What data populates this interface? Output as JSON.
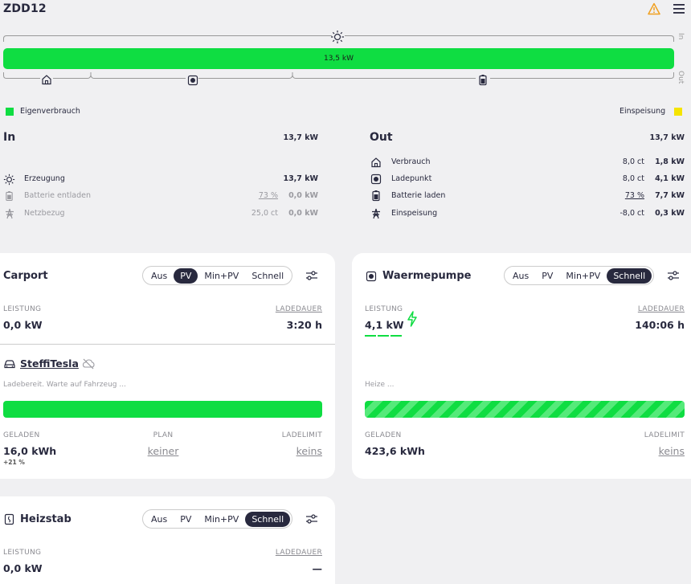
{
  "header": {
    "title": "ZDD12"
  },
  "energyflow": {
    "bar_label": "13,5 kW",
    "in_label": "In",
    "out_label": "Out",
    "legend_self": "Eigenverbrauch",
    "legend_feed": "Einspeisung",
    "colors": {
      "self": "#0fdd42",
      "feed": "#f5e400"
    }
  },
  "inflow": {
    "title": "In",
    "total": "13,7 kW",
    "rows": [
      {
        "label": "Erzeugung",
        "price": "",
        "value": "13,7 kW",
        "icon": "sun-icon"
      },
      {
        "label": "Batterie entladen",
        "price": "73 %",
        "value": "0,0 kW",
        "icon": "battery-icon"
      },
      {
        "label": "Netzbezug",
        "price": "25,0 ct",
        "value": "0,0 kW",
        "icon": "grid-tower-icon"
      }
    ]
  },
  "outflow": {
    "title": "Out",
    "total": "13,7 kW",
    "rows": [
      {
        "label": "Verbrauch",
        "price": "8,0 ct",
        "value": "1,8 kW",
        "icon": "home-icon"
      },
      {
        "label": "Ladepunkt",
        "price": "8,0 ct",
        "value": "4,1 kW",
        "icon": "charger-icon"
      },
      {
        "label": "Batterie laden",
        "price": "73 %",
        "value": "7,7 kW",
        "icon": "battery-icon"
      },
      {
        "label": "Einspeisung",
        "price": "-8,0 ct",
        "value": "0,3 kW",
        "icon": "grid-tower-icon"
      }
    ]
  },
  "modes": [
    "Aus",
    "PV",
    "Min+PV",
    "Schnell"
  ],
  "carport": {
    "title": "Carport",
    "active_mode": "PV",
    "power_label": "LEISTUNG",
    "power": "0,0 kW",
    "duration_label": "LADEDAUER",
    "duration": "3:20 h",
    "vehicle": "SteffiTesla",
    "status": "Ladebereit. Warte auf Fahrzeug ...",
    "progress": 1.0,
    "charged_label": "GELADEN",
    "charged": "16,0 kWh",
    "charged_sub": "+21 %",
    "plan_label": "PLAN",
    "plan": "keiner",
    "limit_label": "LADELIMIT",
    "limit": "keins"
  },
  "waermepumpe": {
    "title": "Waermepumpe",
    "active_mode": "Schnell",
    "power_label": "LEISTUNG",
    "power": "4,1 kW",
    "duration_label": "LADEDAUER",
    "duration": "140:06 h",
    "status": "Heize ...",
    "progress": 1.0,
    "charged_label": "GELADEN",
    "charged": "423,6 kWh",
    "limit_label": "LADELIMIT",
    "limit": "keins"
  },
  "heizstab": {
    "title": "Heizstab",
    "active_mode": "Schnell",
    "power_label": "LEISTUNG",
    "power": "0,0 kW",
    "duration_label": "LADEDAUER",
    "duration": "—"
  }
}
